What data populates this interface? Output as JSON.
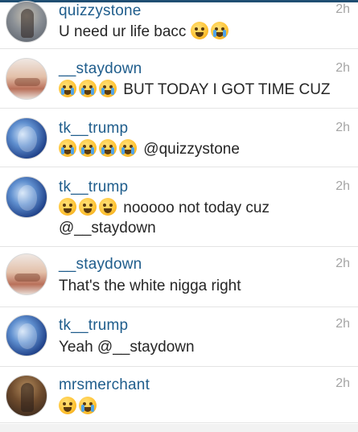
{
  "comments": [
    {
      "username": "quizzystone",
      "time": "2h",
      "text": "U need ur life bacc",
      "emojis": [
        "joy-emoji",
        "crying-emoji"
      ],
      "avatar": "quizzy"
    },
    {
      "username": "__staydown",
      "time": "2h",
      "text": "BUT TODAY I GOT TIME CUZ",
      "emojis": [
        "crying-emoji",
        "crying-emoji",
        "crying-emoji"
      ],
      "avatar": "staydown"
    },
    {
      "username": "tk__trump",
      "time": "2h",
      "text": "@quizzystone",
      "emojis": [
        "crying-emoji",
        "crying-emoji",
        "crying-emoji",
        "crying-emoji"
      ],
      "avatar": "trump"
    },
    {
      "username": "tk__trump",
      "time": "2h",
      "text": "nooooo not today cuz @__staydown",
      "emojis": [
        "weary-emoji",
        "weary-emoji",
        "weary-emoji"
      ],
      "avatar": "trump"
    },
    {
      "username": "__staydown",
      "time": "2h",
      "text": "That's the white nigga right",
      "emojis": [],
      "avatar": "staydown"
    },
    {
      "username": "tk__trump",
      "time": "2h",
      "text": "Yeah @__staydown",
      "emojis": [],
      "avatar": "trump"
    },
    {
      "username": "mrsmerchant",
      "time": "2h",
      "text": "",
      "emojis": [
        "weary-emoji",
        "crying-emoji"
      ],
      "avatar": "merchant"
    }
  ]
}
